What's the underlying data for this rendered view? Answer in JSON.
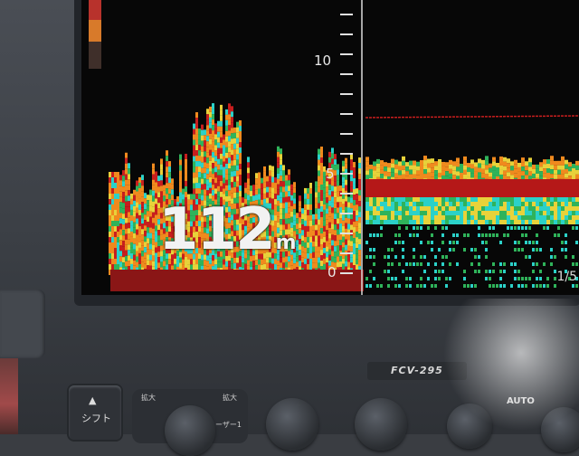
{
  "sounder": {
    "depth_value": "112",
    "depth_unit": "m",
    "scale_labels": [
      "10",
      "5",
      "0"
    ],
    "page_indicator": "1/5"
  },
  "controls": {
    "shift_arrow": "▲",
    "shift_label": "シフト",
    "model": "FCV-295",
    "knob_labels": [
      "拡大",
      "拡大",
      "ユーザー1"
    ],
    "auto_label": "AUTO"
  },
  "colors": {
    "echo_red": "#c81e1e",
    "echo_orange": "#f08a1e",
    "echo_yellow": "#e8d23a",
    "echo_green": "#2fb35a",
    "echo_cyan": "#2bd1c8"
  }
}
